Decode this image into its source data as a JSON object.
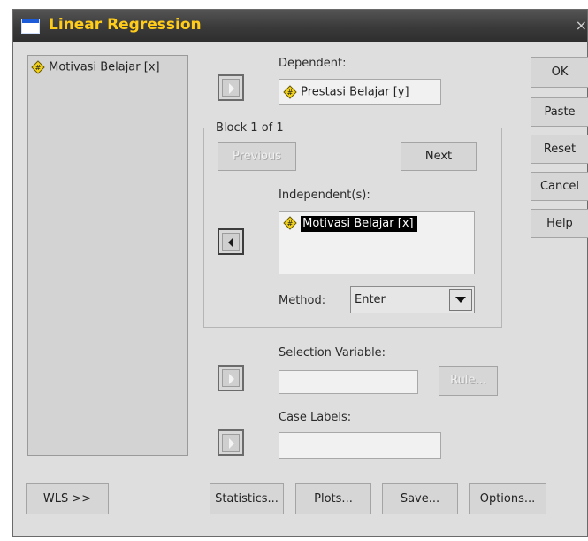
{
  "window": {
    "title": "Linear Regression"
  },
  "source_list": {
    "items": [
      {
        "label": "Motivasi Belajar [x]",
        "icon": "scale-variable-icon"
      }
    ]
  },
  "dependent": {
    "label": "Dependent:",
    "value": "Prestasi Belajar [y]"
  },
  "block": {
    "label": "Block 1 of 1",
    "previous_label": "Previous",
    "next_label": "Next",
    "independent_label": "Independent(s):",
    "independent_items": [
      {
        "label": "Motivasi Belajar [x]",
        "selected": true
      }
    ],
    "method_label": "Method:",
    "method_value": "Enter"
  },
  "selection": {
    "label": "Selection Variable:",
    "rule_label": "Rule..."
  },
  "case_labels": {
    "label": "Case Labels:"
  },
  "side_buttons": {
    "ok": "OK",
    "paste": "Paste",
    "reset": "Reset",
    "cancel": "Cancel",
    "help": "Help"
  },
  "bottom_buttons": {
    "wls": "WLS >>",
    "statistics": "Statistics...",
    "plots": "Plots...",
    "save": "Save...",
    "options": "Options..."
  },
  "colors": {
    "title_text": "#ffcc1a",
    "selection_bg": "#000000",
    "variable_icon": "#f2d21a"
  }
}
